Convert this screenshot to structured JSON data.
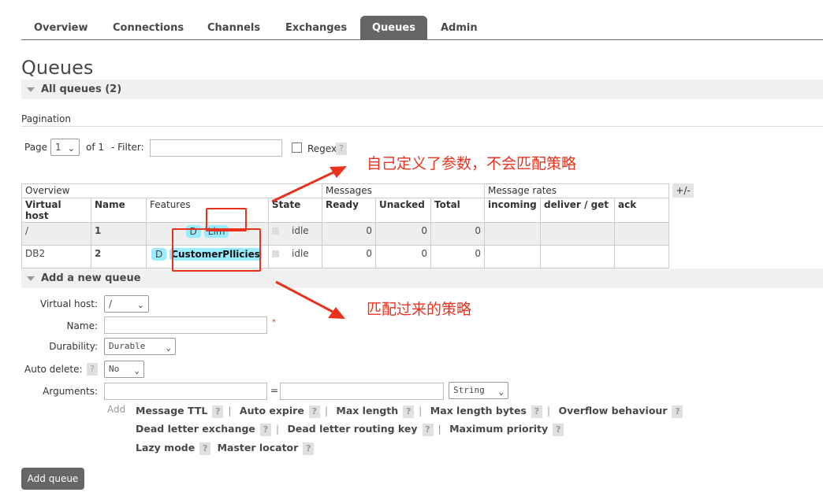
{
  "tabs": [
    {
      "label": "Overview"
    },
    {
      "label": "Connections"
    },
    {
      "label": "Channels"
    },
    {
      "label": "Exchanges"
    },
    {
      "label": "Queues",
      "active": true
    },
    {
      "label": "Admin"
    }
  ],
  "page_title": "Queues",
  "all_queues": {
    "label": "All queues (2)"
  },
  "pagination": {
    "heading": "Pagination",
    "page_label": "Page",
    "page_value": "1",
    "of_label": "of 1",
    "filter_label": "- Filter:",
    "filter_value": "",
    "regex_label": "Regex",
    "help": "?"
  },
  "table": {
    "group_headers": [
      "Overview",
      "Messages",
      "Message rates"
    ],
    "plus_minus": "+/-",
    "columns": [
      "Virtual host",
      "Name",
      "Features",
      "State",
      "Ready",
      "Unacked",
      "Total",
      "incoming",
      "deliver / get",
      "ack"
    ],
    "rows": [
      {
        "vhost": "/",
        "name": "1",
        "features": [
          "D",
          "Lim"
        ],
        "state": "idle",
        "ready": "0",
        "unacked": "0",
        "total": "0"
      },
      {
        "vhost": "DB2",
        "name": "2",
        "features": [
          "D",
          "CustomerPllicies"
        ],
        "state": "idle",
        "ready": "0",
        "unacked": "0",
        "total": "0"
      }
    ]
  },
  "add_queue": {
    "heading": "Add a new queue",
    "vhost_label": "Virtual host:",
    "vhost_value": "/",
    "name_label": "Name:",
    "name_value": "",
    "required_mark": "*",
    "durability_label": "Durability:",
    "durability_value": "Durable",
    "auto_delete_label": "Auto delete:",
    "auto_delete_value": "No",
    "help": "?",
    "arguments_label": "Arguments:",
    "equals": "=",
    "arg_type": "String",
    "add_label": "Add",
    "arg_links": [
      [
        "Message TTL",
        "Auto expire",
        "Max length",
        "Max length bytes",
        "Overflow behaviour"
      ],
      [
        "Dead letter exchange",
        "Dead letter routing key",
        "Maximum priority"
      ],
      [
        "Lazy mode",
        "Master locator"
      ]
    ],
    "submit": "Add queue"
  },
  "annotations": {
    "top": "自己定义了参数，不会匹配策略",
    "bottom": "匹配过来的策略",
    "color": "#e8321e"
  }
}
